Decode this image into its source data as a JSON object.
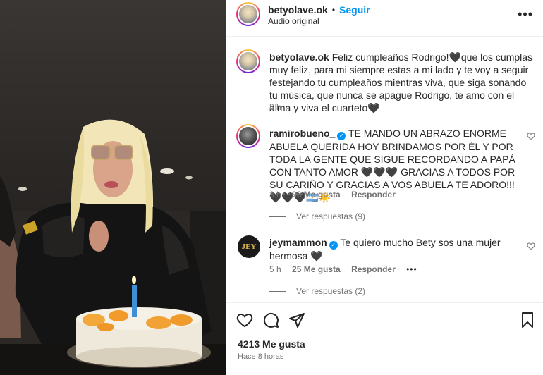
{
  "post": {
    "username": "betyolave.ok",
    "follow_label": "Seguir",
    "audio": "Audio original",
    "more_label": "•••"
  },
  "caption": {
    "username": "betyolave.ok",
    "text": "Feliz cumpleaños Rodrigo!🖤que los cumplas muy feliz, para mi siempre estas a mi lado y te voy a seguir festejando tu cumpleaños mientras viva, que siga sonando tu música, que nunca se apague Rodrigo, te amo con el alma y viva el cuarteto🖤",
    "time": "8 h"
  },
  "comments": [
    {
      "username": "ramirobueno_",
      "verified": true,
      "text": "TE MANDO UN ABRAZO ENORME ABUELA QUERIDA HOY BRINDAMOS POR ÉL Y POR TODA LA GENTE QUE SIGUE RECORDANDO A PAPÁ CON TANTO AMOR 🖤🖤🖤 GRACIAS A TODOS POR SU CARIÑO Y GRACIAS A VOS ABUELA TE ADORO!!! 🖤🖤🖤🇦🇷☀️",
      "time": "3 h",
      "likes": "96 Me gusta",
      "reply_label": "Responder",
      "view_replies": "Ver respuestas (9)"
    },
    {
      "username": "jeymammon",
      "verified": true,
      "avatar_text": "JEY",
      "text": "Te quiero mucho Bety sos una mujer hermosa 🖤",
      "time": "5 h",
      "likes": "25 Me gusta",
      "reply_label": "Responder",
      "more_label": "•••",
      "view_replies": "Ver respuestas (2)"
    }
  ],
  "footer": {
    "likes": "4213 Me gusta",
    "time": "Hace 8 horas"
  }
}
